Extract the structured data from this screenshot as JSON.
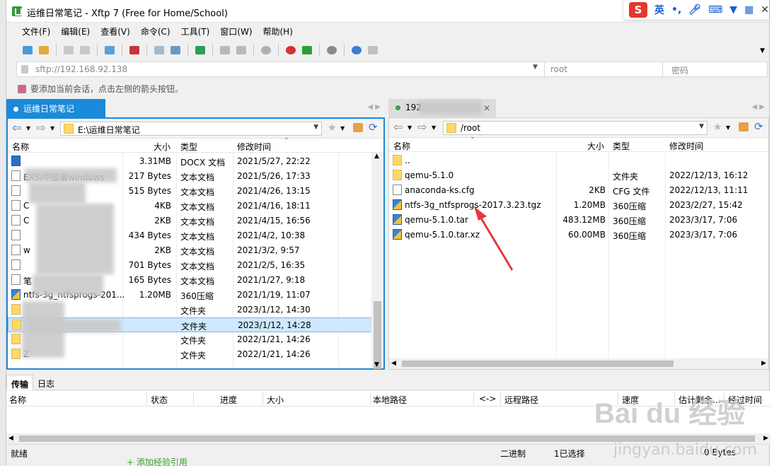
{
  "title": "运维日常笔记 - Xftp 7 (Free for Home/School)",
  "ime": {
    "mode": "英"
  },
  "menu": [
    "文件(F)",
    "编辑(E)",
    "查看(V)",
    "命令(C)",
    "工具(T)",
    "窗口(W)",
    "帮助(H)"
  ],
  "address": {
    "url": "sftp://192.168.92.138",
    "user_placeholder": "root",
    "password_placeholder": "密码"
  },
  "hint": "要添加当前会话，点击左侧的箭头按钮。",
  "tabs": {
    "local": "运维日常笔记",
    "remote": "192"
  },
  "local": {
    "path": "E:\\运维日常笔记",
    "headers": {
      "name": "名称",
      "size": "大小",
      "type": "类型",
      "modified": "修改时间"
    },
    "rows": [
      {
        "name": "",
        "size": "3.31MB",
        "type": "DOCX 文档",
        "modified": "2021/5/27, 22:22",
        "icon": "docx"
      },
      {
        "name": "EXSI中部署windows",
        "size": "217 Bytes",
        "type": "文本文档",
        "modified": "2021/5/26, 17:33",
        "icon": "doc"
      },
      {
        "name": "",
        "size": "515 Bytes",
        "type": "文本文档",
        "modified": "2021/4/26, 13:15",
        "icon": "doc"
      },
      {
        "name": "C",
        "size": "4KB",
        "type": "文本文档",
        "modified": "2021/4/16, 18:11",
        "icon": "doc"
      },
      {
        "name": "C",
        "size": "2KB",
        "type": "文本文档",
        "modified": "2021/4/15, 16:56",
        "icon": "doc"
      },
      {
        "name": "",
        "size": "434 Bytes",
        "type": "文本文档",
        "modified": "2021/4/2, 10:38",
        "icon": "doc"
      },
      {
        "name": "w",
        "size": "2KB",
        "type": "文本文档",
        "modified": "2021/3/2, 9:57",
        "icon": "doc"
      },
      {
        "name": "",
        "size": "701 Bytes",
        "type": "文本文档",
        "modified": "2021/2/5, 16:35",
        "icon": "doc"
      },
      {
        "name": "笔",
        "size": "165 Bytes",
        "type": "文本文档",
        "modified": "2021/1/27, 9:18",
        "icon": "doc"
      },
      {
        "name": "ntfs-3g_ntfsprogs-201...",
        "size": "1.20MB",
        "type": "360压缩",
        "modified": "2021/1/19, 11:07",
        "icon": "zip"
      },
      {
        "name": "",
        "size": "",
        "type": "文件夹",
        "modified": "2023/1/12, 14:30",
        "icon": "folder"
      },
      {
        "name": "",
        "size": "",
        "type": "文件夹",
        "modified": "2023/1/12, 14:28",
        "icon": "folder"
      },
      {
        "name": "",
        "size": "",
        "type": "文件夹",
        "modified": "2022/1/21, 14:26",
        "icon": "folder"
      },
      {
        "name": "Z",
        "size": "",
        "type": "文件夹",
        "modified": "2022/1/21, 14:26",
        "icon": "folder"
      }
    ]
  },
  "remote": {
    "path": "/root",
    "headers": {
      "name": "名称",
      "size": "大小",
      "type": "类型",
      "modified": "修改时间"
    },
    "rows": [
      {
        "name": "..",
        "size": "",
        "type": "",
        "modified": "",
        "icon": "folder"
      },
      {
        "name": "qemu-5.1.0",
        "size": "",
        "type": "文件夹",
        "modified": "2022/12/13, 16:12",
        "icon": "folder"
      },
      {
        "name": "anaconda-ks.cfg",
        "size": "2KB",
        "type": "CFG 文件",
        "modified": "2022/12/13, 11:11",
        "icon": "doc"
      },
      {
        "name": "ntfs-3g_ntfsprogs-2017.3.23.tgz",
        "size": "1.20MB",
        "type": "360压缩",
        "modified": "2023/2/27, 15:42",
        "icon": "zip"
      },
      {
        "name": "qemu-5.1.0.tar",
        "size": "483.12MB",
        "type": "360压缩",
        "modified": "2023/3/17, 7:06",
        "icon": "zip"
      },
      {
        "name": "qemu-5.1.0.tar.xz",
        "size": "60.00MB",
        "type": "360压缩",
        "modified": "2023/3/17, 7:06",
        "icon": "zip"
      }
    ]
  },
  "bottom_tabs": [
    "传输",
    "日志"
  ],
  "transfer_headers": [
    "名称",
    "状态",
    "进度",
    "大小",
    "本地路径",
    "<->",
    "远程路径",
    "速度",
    "估计剩余...",
    "经过时间"
  ],
  "status": {
    "left": "就绪",
    "mode": "二进制",
    "selected": "1已选择",
    "bytes": "0 Bytes"
  },
  "watermark": {
    "logo": "Bai du 经验",
    "site": "jingyan.baidu.com"
  },
  "outside_text": "+ 添加经验引用",
  "colors": {
    "accent": "#1a8ad9",
    "selection": "#cde8ff",
    "arrow": "#e8383a"
  }
}
